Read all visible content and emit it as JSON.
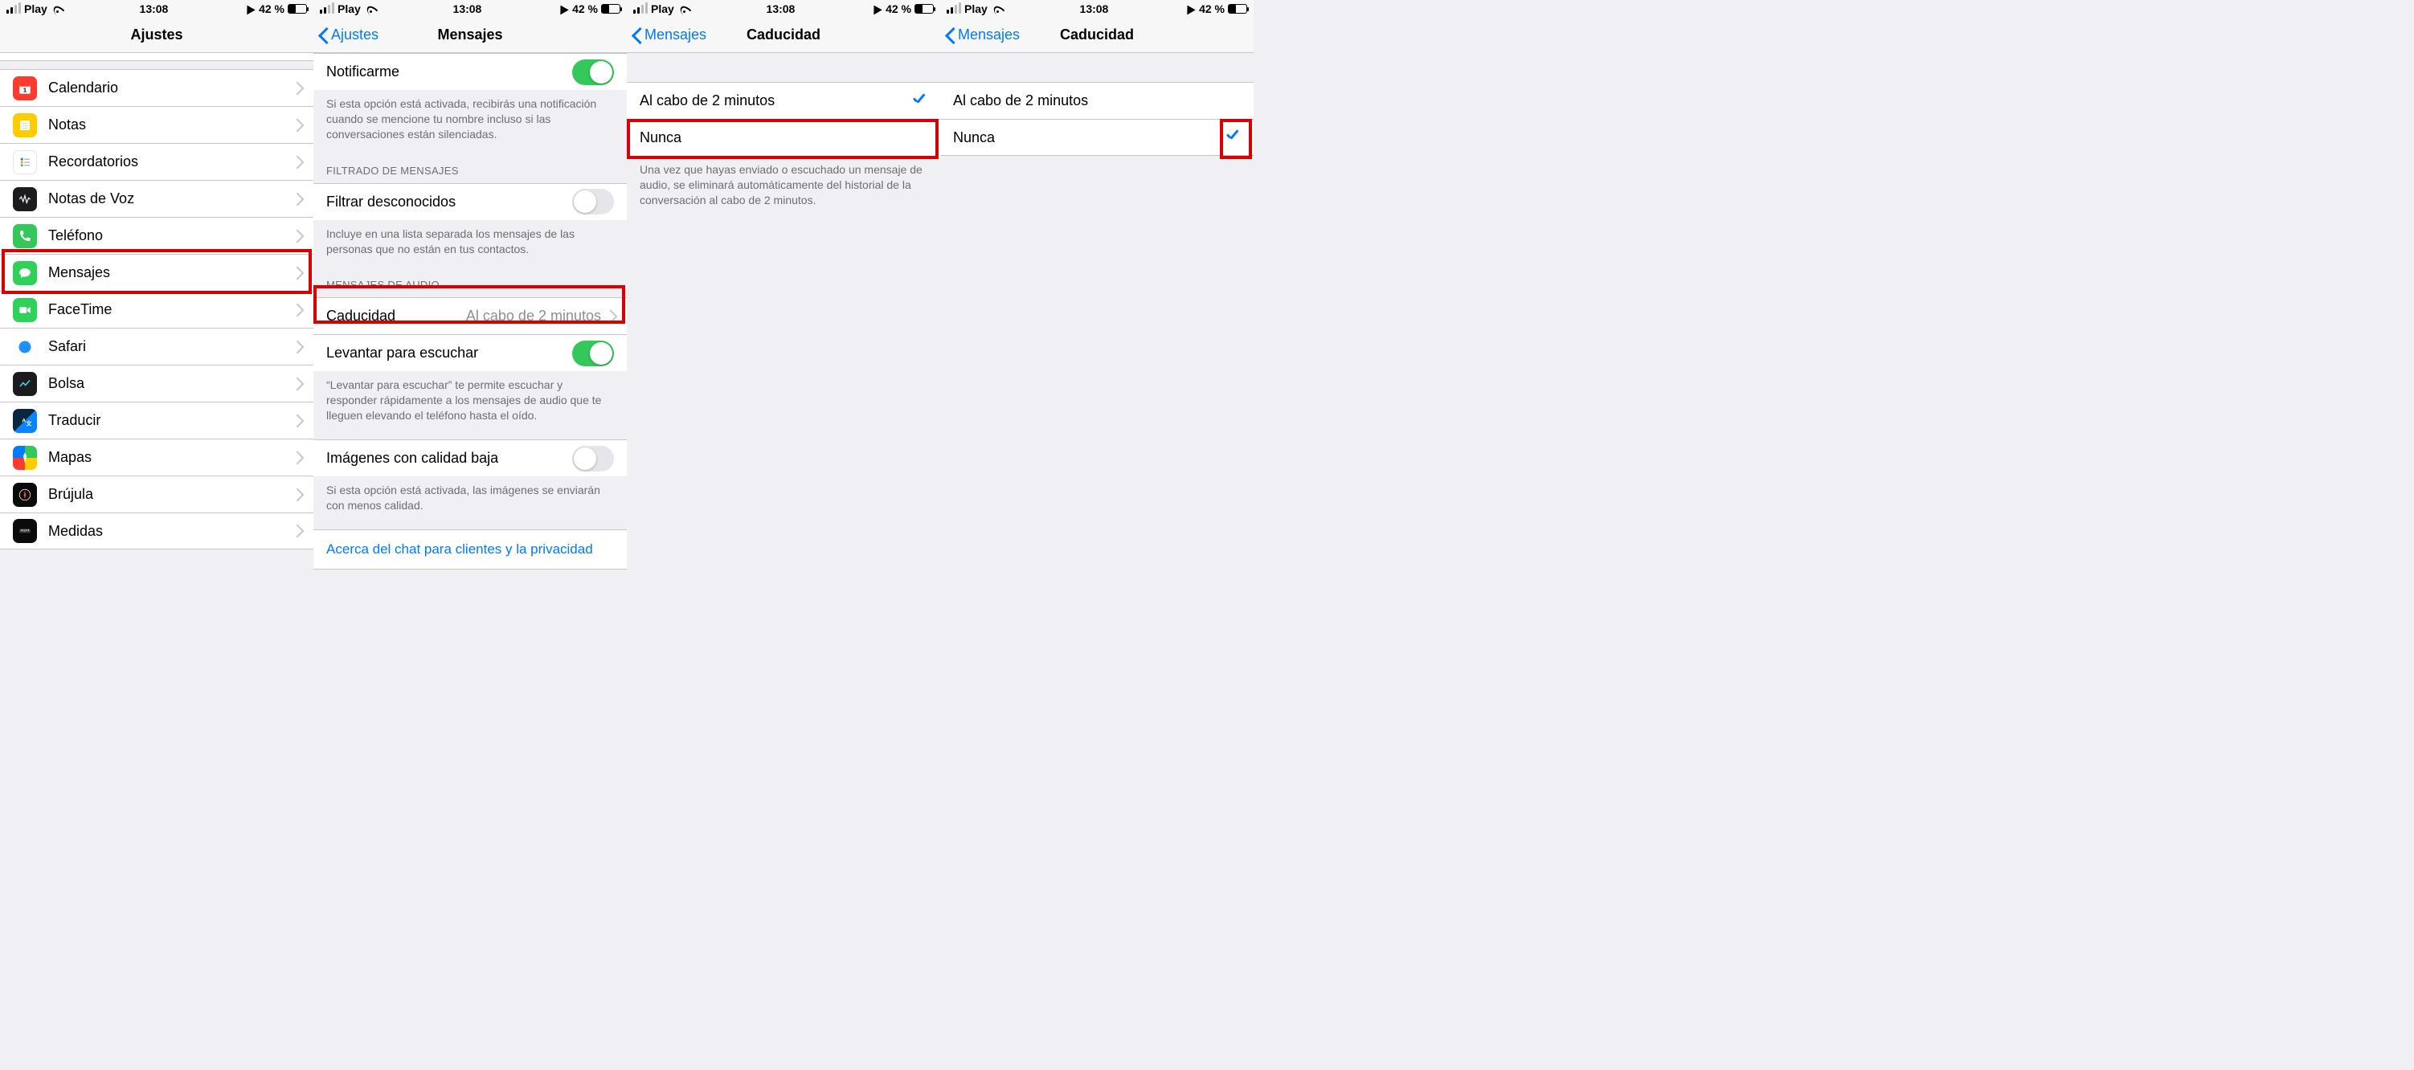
{
  "status": {
    "carrier": "Play",
    "time": "13:08",
    "battery_pct": "42 %"
  },
  "pane1": {
    "title": "Ajustes",
    "rows": [
      {
        "id": "calendario",
        "label": "Calendario"
      },
      {
        "id": "notas",
        "label": "Notas"
      },
      {
        "id": "recordatorios",
        "label": "Recordatorios"
      },
      {
        "id": "notas-voz",
        "label": "Notas de Voz"
      },
      {
        "id": "telefono",
        "label": "Teléfono"
      },
      {
        "id": "mensajes",
        "label": "Mensajes"
      },
      {
        "id": "facetime",
        "label": "FaceTime"
      },
      {
        "id": "safari",
        "label": "Safari"
      },
      {
        "id": "bolsa",
        "label": "Bolsa"
      },
      {
        "id": "traducir",
        "label": "Traducir"
      },
      {
        "id": "mapas",
        "label": "Mapas"
      },
      {
        "id": "brujula",
        "label": "Brújula"
      },
      {
        "id": "medidas",
        "label": "Medidas"
      }
    ]
  },
  "pane2": {
    "back": "Ajustes",
    "title": "Mensajes",
    "notify": {
      "label": "Notificarme",
      "on": true
    },
    "notify_footer": "Si esta opción está activada, recibirás una notificación cuando se mencione tu nombre incluso si las conversaciones están silenciadas.",
    "filter_header": "FILTRADO DE MENSAJES",
    "filter": {
      "label": "Filtrar desconocidos",
      "on": false
    },
    "filter_footer": "Incluye en una lista separada los mensajes de las personas que no están en tus contactos.",
    "audio_header": "MENSAJES DE AUDIO",
    "expire": {
      "label": "Caducidad",
      "value": "Al cabo de 2 minutos"
    },
    "raise": {
      "label": "Levantar para escuchar",
      "on": true
    },
    "raise_footer": "“Levantar para escuchar” te permite escuchar y responder rápidamente a los mensajes de audio que te lleguen elevando el teléfono hasta el oído.",
    "lowq": {
      "label": "Imágenes con calidad baja",
      "on": false
    },
    "lowq_footer": "Si esta opción está activada, las imágenes se enviarán con menos calidad.",
    "about_link": "Acerca del chat para clientes y la privacidad"
  },
  "pane3": {
    "back": "Mensajes",
    "title": "Caducidad",
    "opt1": "Al cabo de 2 minutos",
    "opt2": "Nunca",
    "selected": 0,
    "footer": "Una vez que hayas enviado o escuchado un mensaje de audio, se eliminará automáticamente del historial de la conversación al cabo de 2 minutos."
  },
  "pane4": {
    "back": "Mensajes",
    "title": "Caducidad",
    "opt1": "Al cabo de 2 minutos",
    "opt2": "Nunca",
    "selected": 1
  }
}
